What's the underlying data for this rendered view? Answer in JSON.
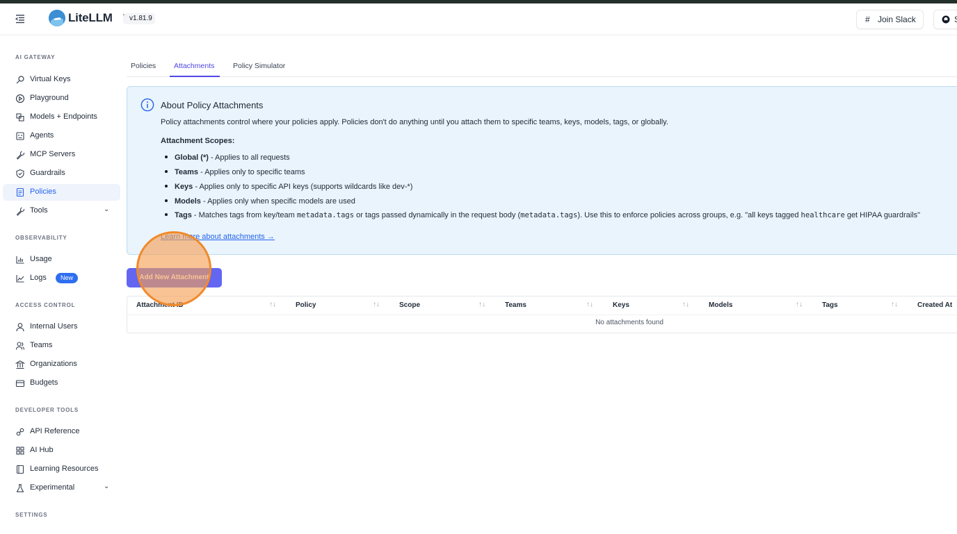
{
  "header": {
    "app_title": "LiteLLM",
    "version": "v1.81.9",
    "join_slack_label": "Join Slack",
    "github_label": "S"
  },
  "sidebar": {
    "sections": [
      {
        "title": "AI GATEWAY"
      },
      {
        "title": "OBSERVABILITY"
      },
      {
        "title": "ACCESS CONTROL"
      },
      {
        "title": "DEVELOPER TOOLS"
      },
      {
        "title": "SETTINGS"
      }
    ],
    "items": [
      {
        "label": "Virtual Keys",
        "icon": "key-icon"
      },
      {
        "label": "Playground",
        "icon": "play-circle-icon"
      },
      {
        "label": "Models + Endpoints",
        "icon": "models-icon"
      },
      {
        "label": "Agents",
        "icon": "robot-icon"
      },
      {
        "label": "MCP Servers",
        "icon": "tool-icon"
      },
      {
        "label": "Guardrails",
        "icon": "shield-icon"
      },
      {
        "label": "Policies",
        "icon": "policy-icon",
        "active": true
      },
      {
        "label": "Tools",
        "icon": "wrench-icon",
        "expandable": true
      },
      {
        "label": "Usage",
        "icon": "bar-chart-icon"
      },
      {
        "label": "Logs",
        "icon": "line-chart-icon",
        "badge": "New"
      },
      {
        "label": "Internal Users",
        "icon": "user-icon"
      },
      {
        "label": "Teams",
        "icon": "team-icon"
      },
      {
        "label": "Organizations",
        "icon": "bank-icon"
      },
      {
        "label": "Budgets",
        "icon": "credit-card-icon"
      },
      {
        "label": "API Reference",
        "icon": "api-icon"
      },
      {
        "label": "AI Hub",
        "icon": "grid-icon"
      },
      {
        "label": "Learning Resources",
        "icon": "book-icon"
      },
      {
        "label": "Experimental",
        "icon": "flask-icon",
        "expandable": true
      }
    ]
  },
  "tabs": [
    {
      "label": "Policies"
    },
    {
      "label": "Attachments",
      "active": true
    },
    {
      "label": "Policy Simulator"
    }
  ],
  "info": {
    "title": "About Policy Attachments",
    "description": "Policy attachments control where your policies apply. Policies don't do anything until you attach them to specific teams, keys, models, tags, or globally.",
    "scopes_title": "Attachment Scopes:",
    "scopes": [
      {
        "name": "Global (*)",
        "text": " - Applies to all requests"
      },
      {
        "name": "Teams",
        "text": " - Applies only to specific teams"
      },
      {
        "name": "Keys",
        "text": " - Applies only to specific API keys (supports wildcards like dev-*)"
      },
      {
        "name": "Models",
        "text": " - Applies only when specific models are used"
      }
    ],
    "tags_scope": {
      "name": "Tags",
      "t1": " - Matches tags from key/team ",
      "code1": "metadata.tags",
      "t2": " or tags passed dynamically in the request body (",
      "code2": "metadata.tags",
      "t3": "). Use this to enforce policies across groups, e.g. \"all keys tagged ",
      "code3": "healthcare",
      "t4": " get HIPAA guardrails\""
    },
    "learn_more": "Learn more about attachments →"
  },
  "add_button_label": "Add New Attachment",
  "table": {
    "columns": [
      "Attachment ID",
      "Policy",
      "Scope",
      "Teams",
      "Keys",
      "Models",
      "Tags",
      "Created At"
    ],
    "sort_glyph": "↑↓",
    "empty_message": "No attachments found"
  },
  "colors": {
    "accent": "#4f46e5",
    "button": "#6366f1",
    "info_bg": "#e9f4fc",
    "active_nav": "#2563eb",
    "click_highlight": "#f08a2c"
  }
}
